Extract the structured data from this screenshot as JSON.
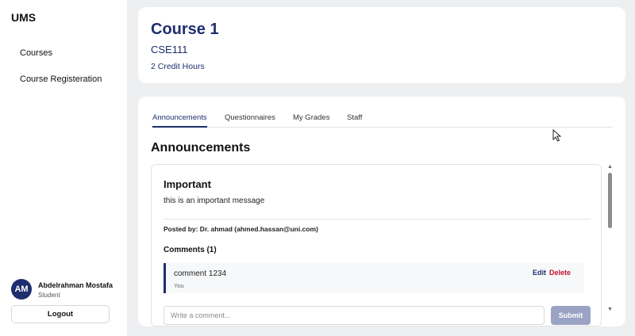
{
  "app": {
    "brand": "UMS"
  },
  "sidebar": {
    "items": [
      {
        "label": "Courses"
      },
      {
        "label": "Course Registeration"
      }
    ]
  },
  "user": {
    "initials": "AM",
    "name": "Abdelrahman Mostafa",
    "role": "Student",
    "logout_label": "Logout"
  },
  "course": {
    "title": "Course 1",
    "code": "CSE111",
    "hours": "2 Credit Hours"
  },
  "tabs": [
    {
      "label": "Announcements",
      "active": true
    },
    {
      "label": "Questionnaires",
      "active": false
    },
    {
      "label": "My Grades",
      "active": false
    },
    {
      "label": "Staff",
      "active": false
    }
  ],
  "section_title": "Announcements",
  "announcement": {
    "title": "Important",
    "message": "this is an important message",
    "posted_by": "Posted by: Dr. ahmad (ahmed.hassan@uni.com)",
    "comments_heading": "Comments (1)",
    "comments": [
      {
        "text": "comment 1234",
        "author": "You",
        "edit_label": "Edit",
        "delete_label": "Delete"
      }
    ],
    "comment_placeholder": "Write a comment...",
    "submit_label": "Submit"
  },
  "icons": {
    "scroll_up": "triangle-up",
    "scroll_down": "triangle-down",
    "cursor": "mouse-pointer"
  },
  "colors": {
    "accent": "#1e2e6e",
    "delete": "#c0102c",
    "submit_disabled": "#9aa3c4",
    "background": "#eeeff1"
  }
}
